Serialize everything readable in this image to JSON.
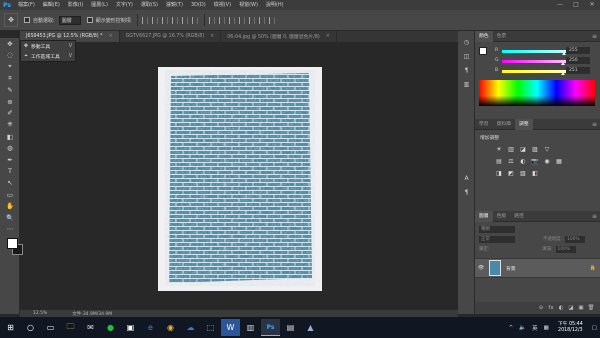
{
  "app": {
    "logo": "Ps"
  },
  "menubar": {
    "items": [
      "檔案(F)",
      "編輯(E)",
      "影像(I)",
      "圖層(L)",
      "文字(Y)",
      "選取(S)",
      "濾鏡(T)",
      "3D(D)",
      "檢視(V)",
      "視窗(W)",
      "說明(H)"
    ],
    "window_controls": [
      "—",
      "□",
      "✕"
    ]
  },
  "optionsbar": {
    "auto_select_label": "自動選取:",
    "auto_select_value": "圖層",
    "transform_label": "顯示變形控制項"
  },
  "tabs": [
    {
      "label": "J6S9453.JPG @ 12.5% (RGB/8) *",
      "active": true
    },
    {
      "label": "GGTV6627.JPG @ 16.7% (RGB/8)",
      "active": false
    },
    {
      "label": "06-04.jpg @ 50% (圖層 0, 圖層遮色片/8)",
      "active": false
    }
  ],
  "toolbar": {
    "tools": [
      "✥",
      "◌",
      "⌖",
      "⌗",
      "✎",
      "⊕",
      "✐",
      "⎈",
      "◧",
      "◍",
      "✒",
      "T",
      "↖",
      "▭",
      "✋",
      "🔍",
      "⋯"
    ]
  },
  "tool_flyout": {
    "items": [
      {
        "icon": "✥",
        "label": "移動工具",
        "key": "V"
      },
      {
        "icon": "⌖",
        "label": "工作區域工具",
        "key": "V"
      }
    ]
  },
  "status": {
    "zoom": "12.5%",
    "doc_info": "文件:34.9M/34.9M"
  },
  "color_panel": {
    "tabs": [
      "顏色",
      "色票"
    ],
    "sliders": [
      {
        "label": "R",
        "value": "255",
        "colors": [
          "#00ffff",
          "#ffffff"
        ],
        "level": 1.0
      },
      {
        "label": "G",
        "value": "250",
        "colors": [
          "#ff00ff",
          "#ffffff"
        ],
        "level": 0.98
      },
      {
        "label": "B",
        "value": "251",
        "colors": [
          "#ffff00",
          "#ffffff"
        ],
        "level": 0.98
      }
    ]
  },
  "adjust_panel": {
    "tabs": [
      "學習",
      "資料庫",
      "調整"
    ],
    "title": "增加調整",
    "row1": [
      "☀",
      "▥",
      "◪",
      "▨",
      "▽"
    ],
    "row2": [
      "▤",
      "⚖",
      "◐",
      "📷",
      "◉",
      "▦"
    ],
    "row3": [
      "◨",
      "◩",
      "▧",
      "◧"
    ]
  },
  "layers_panel": {
    "tabs": [
      "圖層",
      "色版",
      "路徑"
    ],
    "kind_label": "種類",
    "blend_mode": "正常",
    "opacity_label": "不透明度:",
    "opacity_value": "100%",
    "lock_label": "鎖定:",
    "fill_label": "填滿:",
    "fill_value": "100%",
    "layer_name": "背景",
    "footer_icons": [
      "⊝",
      "fx",
      "◐",
      "◪",
      "▣",
      "🗑"
    ]
  },
  "taskbar": {
    "icons": [
      "⊞",
      "○",
      "▭",
      "🗀",
      "✉",
      "●",
      "▣",
      "e",
      "◉",
      "☁",
      "⬚",
      "W",
      "▥",
      "Ps",
      "▤",
      "▲"
    ],
    "active_index": 13,
    "tray": [
      "^",
      "🔈",
      "英",
      "▦"
    ],
    "time": "下午 05:44",
    "date": "2018/12/3"
  }
}
